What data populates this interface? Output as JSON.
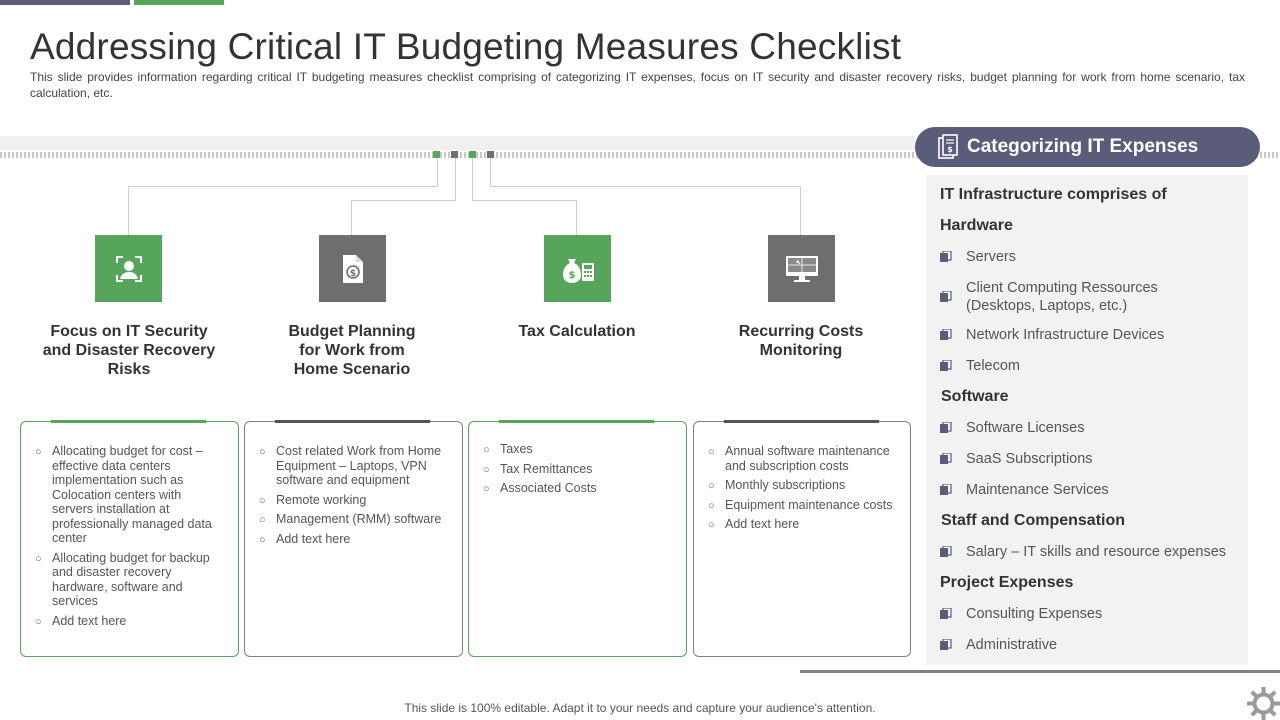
{
  "slide": {
    "title": "Addressing Critical IT Budgeting Measures Checklist",
    "subtitle": "This slide provides information regarding critical IT budgeting measures checklist comprising of categorizing IT expenses, focus on IT security and disaster recovery risks, budget planning for work from home scenario, tax calculation, etc.",
    "footer": "This slide is 100% editable. Adapt it to your needs and capture your audience's attention."
  },
  "colors": {
    "green": "#57a55a",
    "gray": "#6e6e6e",
    "purple": "#5a5c7a",
    "panel": "#f2f2f2"
  },
  "columns": [
    {
      "icon": "person-scan-icon",
      "title": "Focus on IT Security and Disaster Recovery Risks",
      "bullets": [
        "Allocating budget for cost – effective data centers implementation such as Colocation centers with servers installation at professionally managed data center",
        "Allocating budget for backup and disaster recovery hardware, software and services",
        "Add text here"
      ]
    },
    {
      "icon": "dollar-document-icon",
      "title": "Budget Planning for Work from Home Scenario",
      "bullets": [
        "Cost related Work from Home Equipment – Laptops, VPN software and equipment",
        "Remote working",
        "Management (RMM) software",
        "Add text here"
      ]
    },
    {
      "icon": "money-bag-calculator-icon",
      "title": "Tax Calculation",
      "bullets": [
        "Taxes",
        "Tax Remittances",
        "Associated Costs"
      ]
    },
    {
      "icon": "monitor-icon",
      "title": "Recurring Costs Monitoring",
      "bullets": [
        "Annual software maintenance and subscription costs",
        "Monthly subscriptions",
        "Equipment maintenance costs",
        "Add text here"
      ]
    }
  ],
  "right_panel": {
    "header": "Categorizing IT Expenses",
    "intro": "IT Infrastructure comprises of",
    "hardware_heading": "Hardware",
    "hardware": [
      "Servers",
      "Client Computing Ressources (Desktops, Laptops, etc.)",
      "Network Infrastructure Devices",
      "Telecom"
    ],
    "software_heading": "Software",
    "software": [
      "Software Licenses",
      "SaaS Subscriptions",
      "Maintenance Services"
    ],
    "staff_heading": "Staff and Compensation",
    "staff": [
      "Salary – IT skills and resource expenses"
    ],
    "project_heading": "Project Expenses",
    "project": [
      "Consulting Expenses",
      "Administrative"
    ]
  }
}
